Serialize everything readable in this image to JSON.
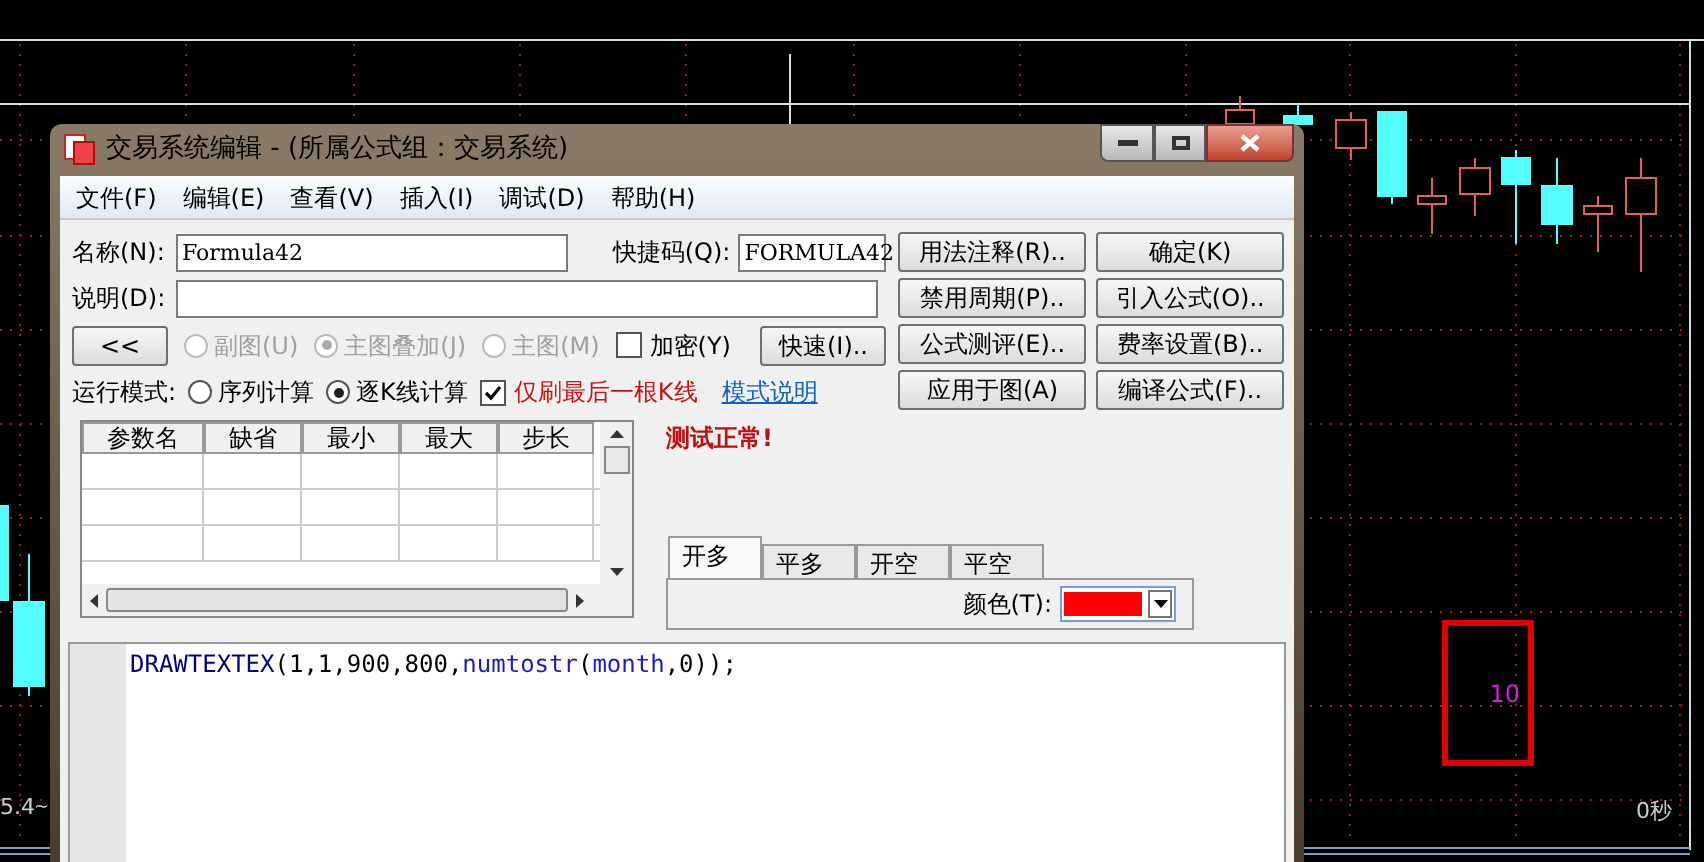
{
  "chart": {
    "price_label": "5.4",
    "price_marker": "~",
    "timer": "0秒",
    "box_text": "10"
  },
  "window": {
    "title": "交易系统编辑 - (所属公式组：交易系统)"
  },
  "menu": [
    "文件(F)",
    "编辑(E)",
    "查看(V)",
    "插入(I)",
    "调试(D)",
    "帮助(H)"
  ],
  "name_field": {
    "label": "名称(N):",
    "value": "Formula42"
  },
  "shortcut_field": {
    "label": "快捷码(Q):",
    "value": "FORMULA42"
  },
  "description_field": {
    "label": "说明(D):"
  },
  "collapse_button": "<<",
  "chart_type": [
    {
      "label": "副图(U)",
      "selected": false,
      "disabled": true
    },
    {
      "label": "主图叠加(J)",
      "selected": true,
      "disabled": true
    },
    {
      "label": "主图(M)",
      "selected": false,
      "disabled": true
    }
  ],
  "encrypt": {
    "label": "加密(Y)",
    "checked": false
  },
  "quick_button": "快速(I)..",
  "run_mode": {
    "label": "运行模式:",
    "options": [
      {
        "label": "序列计算",
        "selected": false
      },
      {
        "label": "逐K线计算",
        "selected": true
      }
    ]
  },
  "refresh_last": {
    "label": "仅刷最后一根K线",
    "checked": true
  },
  "mode_link": "模式说明",
  "buttons": [
    [
      "用法注释(R)..",
      "确定(K)"
    ],
    [
      "禁用周期(P)..",
      "引入公式(O).."
    ],
    [
      "公式测评(E)..",
      "费率设置(B).."
    ],
    [
      "应用于图(A)",
      "编译公式(F).."
    ]
  ],
  "status": "测试正常!",
  "param_table": {
    "columns": [
      "参数名",
      "缺省",
      "最小",
      "最大",
      "步长"
    ]
  },
  "tabs": [
    {
      "label": "开多",
      "selected": true
    },
    {
      "label": "平多",
      "selected": false
    },
    {
      "label": "开空",
      "selected": false
    },
    {
      "label": "平空",
      "selected": false
    }
  ],
  "color_picker": {
    "label": "颜色(T):",
    "color": "#ff0000"
  },
  "editor": {
    "lines": [
      [
        {
          "text": "DRAWTEXTEX",
          "kind": "keyword"
        },
        {
          "text": "(1,1,900,800,",
          "kind": "plain"
        },
        {
          "text": "numtostr",
          "kind": "function"
        },
        {
          "text": "(",
          "kind": "plain"
        },
        {
          "text": "month",
          "kind": "function"
        },
        {
          "text": ",0));",
          "kind": "plain"
        }
      ]
    ]
  }
}
